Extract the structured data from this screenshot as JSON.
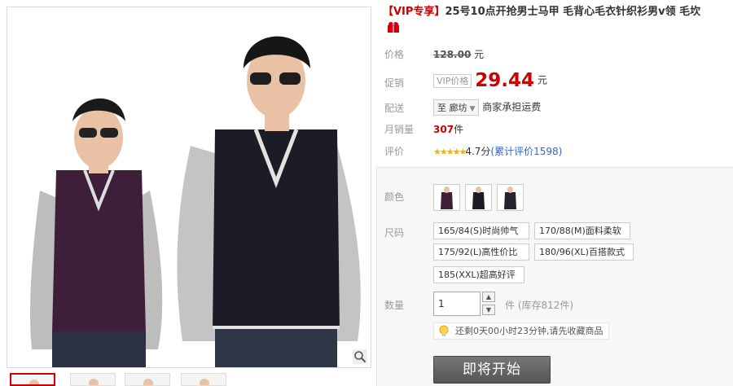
{
  "product": {
    "title_vip": "【VIP专享】",
    "title_rest": "25号10点开抢男士马甲 毛背心毛衣针织衫男v领 毛坎",
    "gift_icon": "gift-icon"
  },
  "price": {
    "label": "价格",
    "original": "128.00",
    "unit": "元"
  },
  "promo": {
    "label": "促销",
    "tag": "VIP价格",
    "price": "29.44",
    "unit": "元"
  },
  "delivery": {
    "label": "配送",
    "to": "至 廊坊",
    "note": "商家承担运费"
  },
  "sales": {
    "label": "月销量",
    "count": "307",
    "unit": "件"
  },
  "rating": {
    "label": "评价",
    "stars": "★★★★★",
    "score": "4.7分",
    "reviews": "(累计评价1598)"
  },
  "color": {
    "label": "颜色",
    "swatches": [
      "purple-vest",
      "black-vest",
      "dark-vest"
    ]
  },
  "size": {
    "label": "尺码",
    "options": [
      "165/84(S)时尚帅气",
      "170/88(M)面料柔软",
      "175/92(L)高性价比",
      "180/96(XL)百搭款式",
      "185(XXL)超高好评"
    ]
  },
  "quantity": {
    "label": "数量",
    "value": "1",
    "unit_stock": "件 (库存812件)"
  },
  "tip": {
    "text": "还剩0天00小时23分钟,请先收藏商品",
    "icon": "lightbulb-icon"
  },
  "buy": {
    "label": "即将开始"
  },
  "colors": {
    "price_red": "#cc0000",
    "link_blue": "#3366cc",
    "star_yellow": "#f6b300",
    "vest_purple": "#3d1f3a",
    "vest_black": "#1c1c26"
  }
}
